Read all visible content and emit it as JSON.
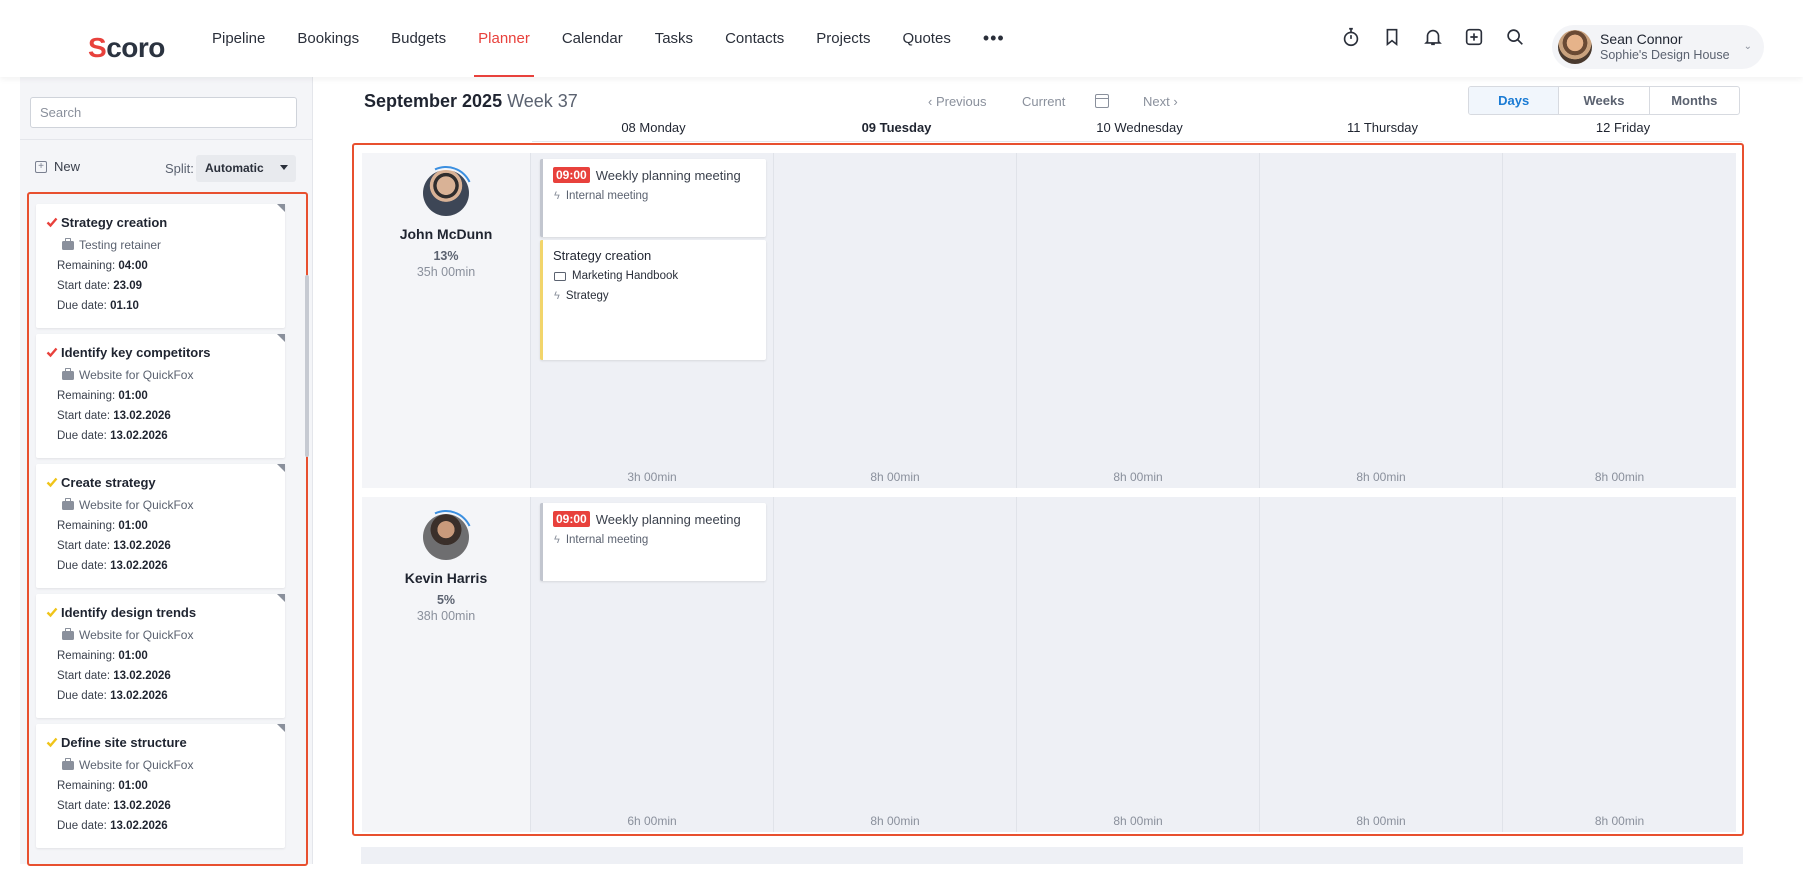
{
  "app": {
    "logo_text": "Scoro"
  },
  "nav": {
    "items": [
      {
        "label": "Pipeline"
      },
      {
        "label": "Bookings"
      },
      {
        "label": "Budgets"
      },
      {
        "label": "Planner",
        "active": true
      },
      {
        "label": "Calendar"
      },
      {
        "label": "Tasks"
      },
      {
        "label": "Contacts"
      },
      {
        "label": "Projects"
      },
      {
        "label": "Quotes"
      }
    ],
    "more_label": "•••"
  },
  "top_icons": [
    "timer-icon",
    "bookmark-icon",
    "bell-icon",
    "add-icon",
    "search-icon"
  ],
  "user": {
    "name": "Sean Connor",
    "org": "Sophie's Design House"
  },
  "left_panel": {
    "search_placeholder": "Search",
    "new_label": "New",
    "split_label": "Split:",
    "split_value": "Automatic",
    "remaining_label": "Remaining:",
    "start_label": "Start date:",
    "due_label": "Due date:",
    "tasks": [
      {
        "title": "Strategy creation",
        "project": "Testing retainer",
        "remaining": "04:00",
        "start": "23.09",
        "due": "01.10",
        "check_color": "#e8413c"
      },
      {
        "title": "Identify key competitors",
        "project": "Website for QuickFox",
        "remaining": "01:00",
        "start": "13.02.2026",
        "due": "13.02.2026",
        "check_color": "#e8413c"
      },
      {
        "title": "Create strategy",
        "project": "Website for QuickFox",
        "remaining": "01:00",
        "start": "13.02.2026",
        "due": "13.02.2026",
        "check_color": "#f0c419"
      },
      {
        "title": "Identify design trends",
        "project": "Website for QuickFox",
        "remaining": "01:00",
        "start": "13.02.2026",
        "due": "13.02.2026",
        "check_color": "#f0c419"
      },
      {
        "title": "Define site structure",
        "project": "Website for QuickFox",
        "remaining": "01:00",
        "start": "13.02.2026",
        "due": "13.02.2026",
        "check_color": "#f0c419"
      }
    ]
  },
  "planner": {
    "month": "September 2025",
    "week": "Week 37",
    "prev_label": "‹  Previous",
    "current_label": "Current",
    "next_label": "Next  ›",
    "views": [
      {
        "label": "Days",
        "active": true
      },
      {
        "label": "Weeks"
      },
      {
        "label": "Months"
      }
    ],
    "days": [
      {
        "label": "08 Monday"
      },
      {
        "label": "09 Tuesday",
        "bold": true
      },
      {
        "label": "10 Wednesday"
      },
      {
        "label": "11 Thursday"
      },
      {
        "label": "12 Friday"
      }
    ],
    "resources": [
      {
        "name": "John McDunn",
        "utilization": "13%",
        "hours": "35h 00min",
        "capacity": [
          "3h 00min",
          "8h 00min",
          "8h 00min",
          "8h 00min",
          "8h 00min"
        ],
        "events": [
          {
            "type": "meeting",
            "time": "09:00",
            "title": "Weekly planning meeting",
            "activity": "Internal meeting"
          },
          {
            "type": "task",
            "title": "Strategy creation",
            "project": "Marketing Handbook",
            "activity": "Strategy"
          }
        ]
      },
      {
        "name": "Kevin Harris",
        "utilization": "5%",
        "hours": "38h 00min",
        "capacity": [
          "6h 00min",
          "8h 00min",
          "8h 00min",
          "8h 00min",
          "8h 00min"
        ],
        "events": [
          {
            "type": "meeting",
            "time": "09:00",
            "title": "Weekly planning meeting",
            "activity": "Internal meeting"
          }
        ]
      }
    ]
  },
  "colors": {
    "accent": "#e8413c",
    "highlight_outline": "#e8502f",
    "active_view": "#1a7bd4"
  }
}
